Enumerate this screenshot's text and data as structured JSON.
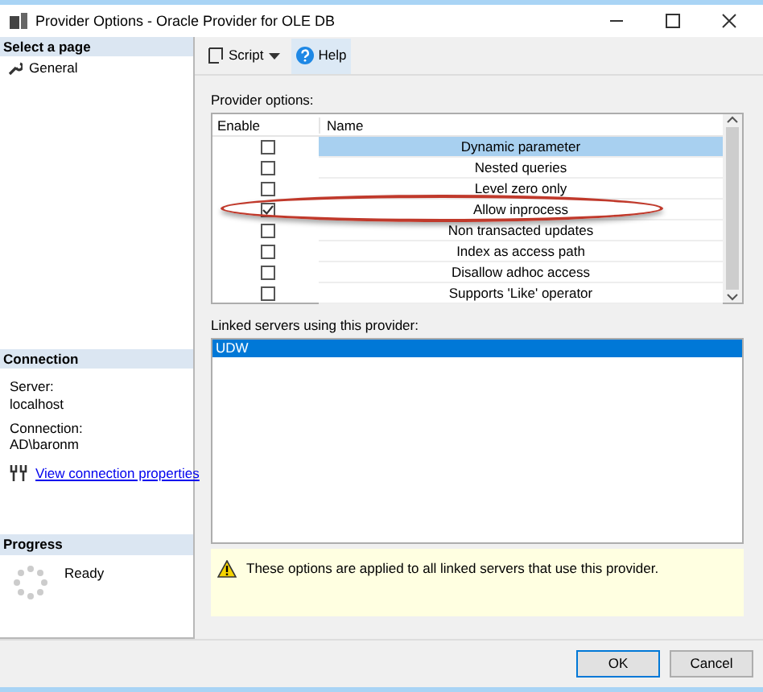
{
  "window": {
    "title": "Provider Options - Oracle Provider for OLE DB"
  },
  "sidebar": {
    "header": "Select a page",
    "pages": [
      {
        "label": "General",
        "selected": false
      }
    ]
  },
  "connection": {
    "header": "Connection",
    "server_label": "Server:",
    "server": "localhost",
    "connection_label": "Connection:",
    "connection": "AD\\baronm",
    "link": "View connection properties"
  },
  "progress": {
    "header": "Progress",
    "status": "Ready"
  },
  "toolbar": {
    "script": "Script",
    "help": "Help"
  },
  "provider_options": {
    "label": "Provider options:",
    "columns": [
      "Enable",
      "Name"
    ],
    "rows": [
      {
        "name": "Dynamic parameter",
        "checked": false,
        "selected": true,
        "highlighted": false
      },
      {
        "name": "Nested queries",
        "checked": false,
        "selected": false,
        "highlighted": false
      },
      {
        "name": "Level zero only",
        "checked": false,
        "selected": false,
        "highlighted": false
      },
      {
        "name": "Allow inprocess",
        "checked": true,
        "selected": false,
        "highlighted": true
      },
      {
        "name": "Non transacted updates",
        "checked": false,
        "selected": false,
        "highlighted": false
      },
      {
        "name": "Index as access path",
        "checked": false,
        "selected": false,
        "highlighted": false
      },
      {
        "name": "Disallow adhoc access",
        "checked": false,
        "selected": false,
        "highlighted": false
      },
      {
        "name": "Supports 'Like' operator",
        "checked": false,
        "selected": false,
        "highlighted": false
      }
    ]
  },
  "linked_servers": {
    "label": "Linked servers using this provider:",
    "items": [
      {
        "name": "UDW",
        "selected": true
      }
    ]
  },
  "warning": "These options are applied to all linked servers that use this provider.",
  "buttons": [
    {
      "label": "OK",
      "default": true
    },
    {
      "label": "Cancel",
      "default": false
    }
  ]
}
